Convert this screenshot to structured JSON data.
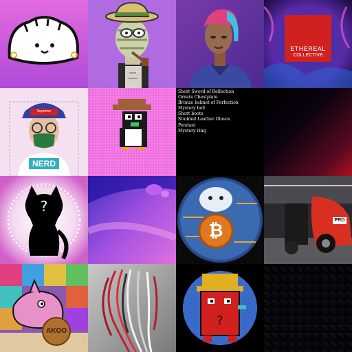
{
  "tiles": [
    {
      "name": "dumpling-nft"
    },
    {
      "name": "zombie-explorer-nft"
    },
    {
      "name": "cyberpunk-girl-nft"
    },
    {
      "name": "ethereal-collective-nft",
      "brand_line1": "ETHEREAL",
      "brand_line2": "COLLECTIVE"
    },
    {
      "name": "nerd-avatar-nft",
      "hat_text": "Supreme",
      "shirt_text": "NERD"
    },
    {
      "name": "pixel-penguin-nft"
    },
    {
      "name": "loot-bag-nft",
      "items": [
        "Short Sword of Reflection",
        "Ornate Chestplate",
        "Bronze helmet of Perfection",
        "Mystery belt",
        "Short boots",
        "Studded Leather Gloves",
        "Pendant",
        "Mystery ring"
      ]
    },
    {
      "name": "red-black-gradient-nft"
    },
    {
      "name": "mystery-silhouette-nft",
      "mark": "?"
    },
    {
      "name": "purple-abstract-nft"
    },
    {
      "name": "bitcoin-hedgehog-nft",
      "coin_symbol": "₿"
    },
    {
      "name": "race-car-nft",
      "plate": "PRO"
    },
    {
      "name": "pink-dolphin-nft",
      "coin_text": "AKOO"
    },
    {
      "name": "wire-hair-sculpture-nft"
    },
    {
      "name": "pixel-worker-nft",
      "mark": "?"
    },
    {
      "name": "dark-circuit-nft"
    }
  ],
  "colors": {
    "loot_text": "#ffffff",
    "loot_bg": "#000000"
  }
}
